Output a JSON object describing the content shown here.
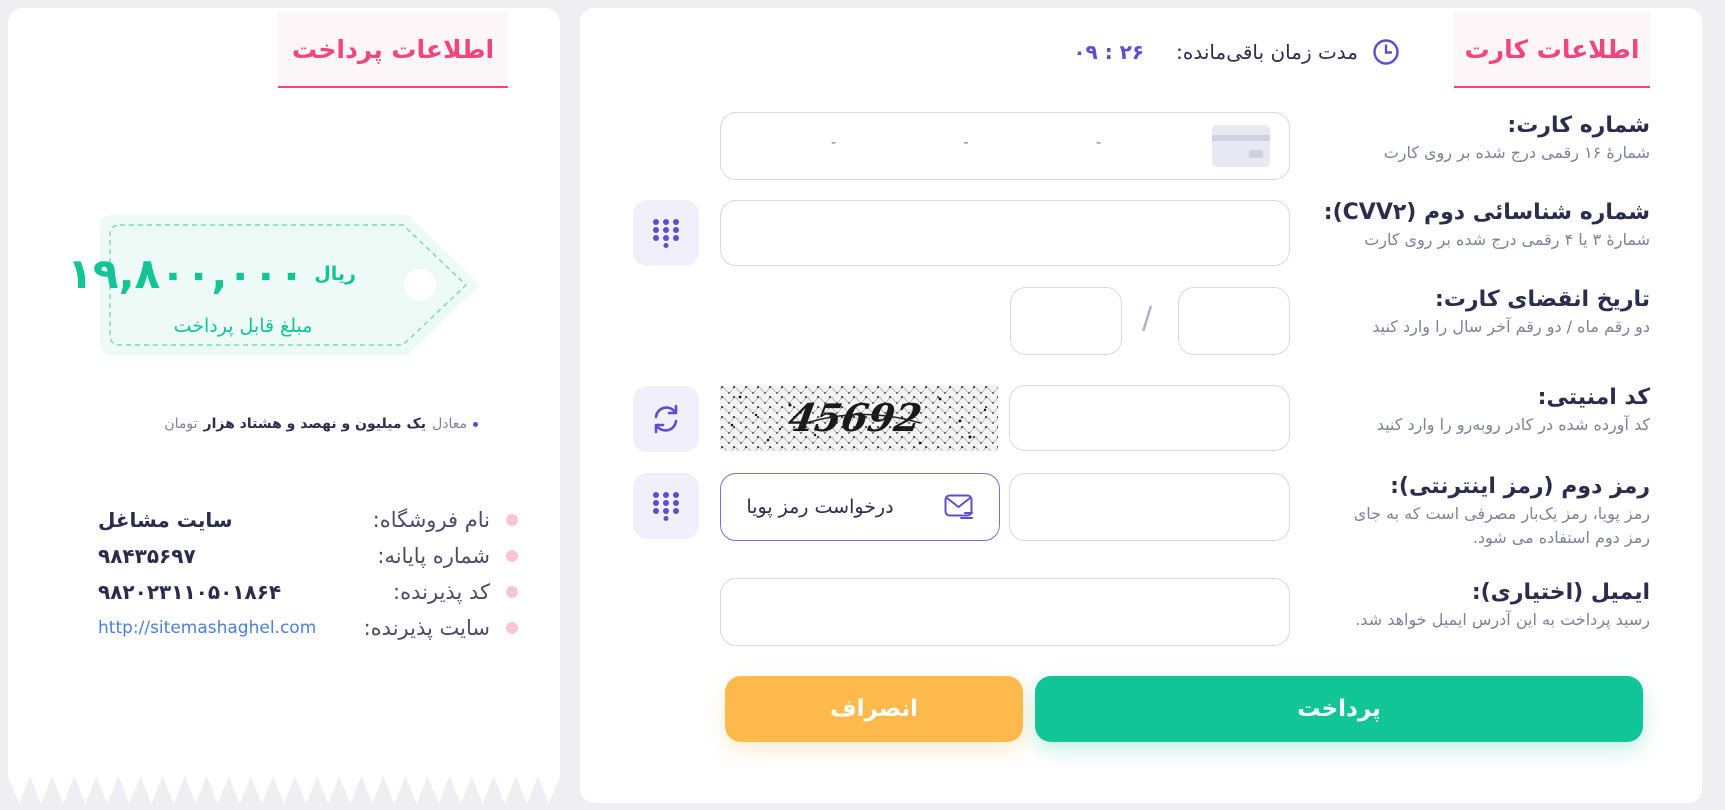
{
  "card_panel": {
    "title": "اطلاعات کارت",
    "timer": {
      "label": "مدت زمان باقی‌مانده:",
      "value": "۰۹ : ۲۶"
    },
    "card_number": {
      "label": "شماره کارت:",
      "hint": "شمارهٔ ۱۶ رقمی درج شده بر روی کارت",
      "separators": [
        "-",
        "-",
        "-"
      ]
    },
    "cvv2": {
      "label": "شماره شناسائی دوم (CVV۲):",
      "hint": "شمارهٔ ۳ یا ۴ رقمی درج شده بر روی کارت"
    },
    "expiry": {
      "label": "تاریخ انقضای کارت:",
      "hint": "دو رقم ماه / دو رقم آخر سال را وارد کنید",
      "separator": "/"
    },
    "captcha": {
      "label": "کد امنیتی:",
      "hint": "کد آورده شده در کادر روبه‌رو را وارد کنید",
      "image_text": "45692"
    },
    "second_password": {
      "label": "رمز دوم (رمز اینترنتی):",
      "hint_line1": "رمز پویا، رمز یک‌بار مصرفی است که به جای",
      "hint_line2": "رمز دوم استفاده می شود.",
      "otp_button": "درخواست رمز پویا"
    },
    "email": {
      "label": "ایمیل (اختیاری):",
      "hint": "رسید پرداخت به این آدرس ایمیل خواهد شد."
    },
    "pay_button": "پرداخت",
    "cancel_button": "انصراف"
  },
  "payment_panel": {
    "title": "اطلاعات پرداخت",
    "amount": "۱۹,۸۰۰,۰۰۰",
    "currency": "ریال",
    "amount_label": "مبلغ قابل پرداخت",
    "words_prefix": "معادل",
    "words_bold": "یک میلیون و نهصد و هشتاد هزار",
    "words_suffix": "تومان",
    "info": [
      {
        "key": "نام فروشگاه:",
        "value": "سایت مشاغل"
      },
      {
        "key": "شماره پایانه:",
        "value": "۹۸۴۳۵۶۹۷"
      },
      {
        "key": "کد پذیرنده:",
        "value": "۹۸۲۰۲۳۱۱۰۵۰۱۸۶۴"
      },
      {
        "key": "سایت پذیرنده:",
        "value": "http://sitemashaghel.com"
      }
    ]
  },
  "colors": {
    "accent_pink": "#f2457b",
    "primary_green": "#12c596",
    "cancel_orange": "#fdb94c",
    "purple": "#5b4fcf"
  },
  "icons": [
    "clock-icon",
    "credit-card-icon",
    "keypad-icon",
    "refresh-icon",
    "envelope-icon"
  ]
}
